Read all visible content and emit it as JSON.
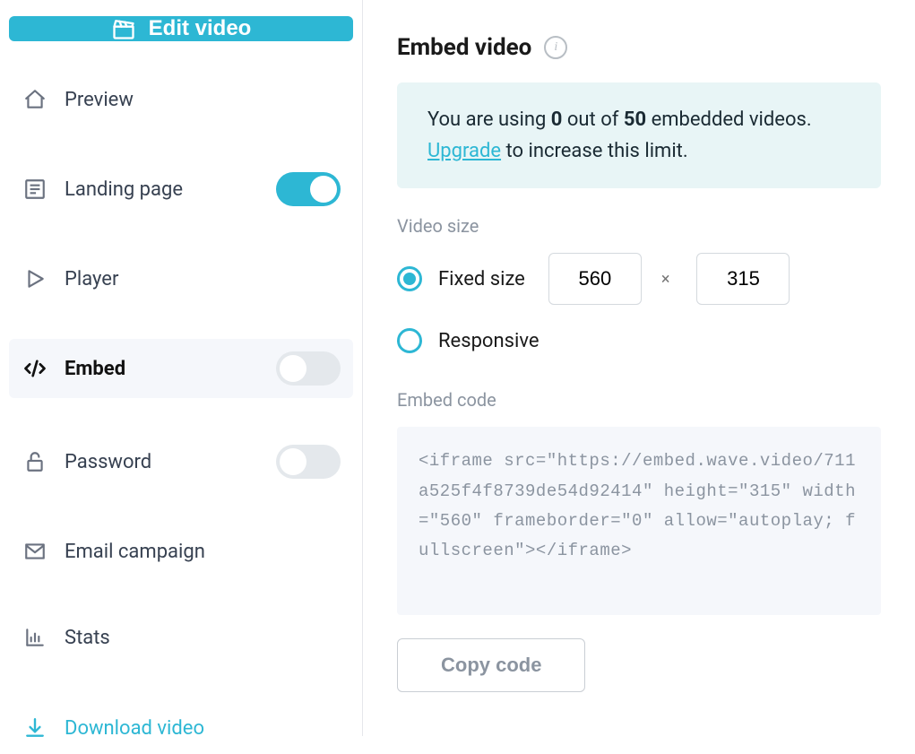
{
  "sidebar": {
    "edit_label": "Edit video",
    "items": {
      "preview": "Preview",
      "landing": "Landing page",
      "player": "Player",
      "embed": "Embed",
      "password": "Password",
      "email": "Email campaign",
      "stats": "Stats",
      "download": "Download video"
    }
  },
  "main": {
    "title": "Embed video",
    "notice": {
      "prefix": "You are using ",
      "used": "0",
      "middle": " out of ",
      "total": "50",
      "suffix": " embedded videos. ",
      "link": "Upgrade",
      "tail": " to increase this limit."
    },
    "video_size_label": "Video size",
    "fixed_label": "Fixed size",
    "responsive_label": "Responsive",
    "width": "560",
    "height": "315",
    "times": "×",
    "embed_code_label": "Embed code",
    "code": "<iframe src=\"https://embed.wave.video/711a525f4f8739de54d92414\" height=\"315\" width=\"560\" frameborder=\"0\" allow=\"autoplay; fullscreen\"></iframe>",
    "copy_label": "Copy code"
  }
}
